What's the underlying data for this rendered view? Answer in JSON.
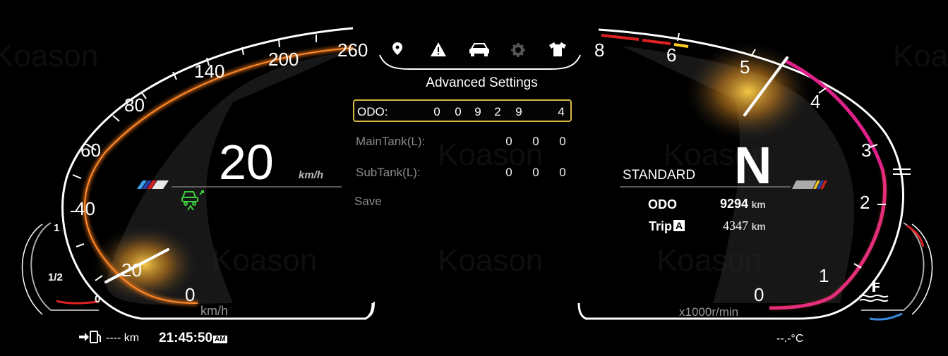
{
  "colors": {
    "background": "#000000",
    "arc_orange": "#ff7a1a",
    "rpm_magenta": "#e0208a",
    "redline": "#e02020",
    "selection_border": "#d4b642",
    "glow_yellow": "#ffd24a",
    "eco_green": "#3ccf3c"
  },
  "speedometer": {
    "tick_labels": [
      "0",
      "20",
      "40",
      "60",
      "80",
      "140",
      "200",
      "260"
    ],
    "unit": "km/h",
    "speed_value": "20",
    "speed_unit": "km/h",
    "needle_value_kmh": 20
  },
  "tachometer": {
    "tick_labels": [
      "0",
      "1",
      "2",
      "3",
      "4",
      "5",
      "6",
      "8"
    ],
    "unit": "x1000r/min",
    "needle_value_krpm": 5.2
  },
  "fuel_gauge": {
    "labels": [
      "1",
      "1/2",
      "0"
    ]
  },
  "menu": {
    "icons": [
      "location-pin-icon",
      "warning-triangle-icon",
      "car-icon",
      "gear-icon",
      "shirt-icon"
    ],
    "title": "Advanced Settings",
    "rows": [
      {
        "label": "ODO:",
        "digits": [
          "0",
          "0",
          "9",
          "2",
          "9",
          "4"
        ]
      },
      {
        "label": "MainTank(L):",
        "digits": [
          "0",
          "0",
          "0"
        ]
      },
      {
        "label": "SubTank(L):",
        "digits": [
          "0",
          "0",
          "0"
        ]
      }
    ],
    "save_label": "Save"
  },
  "right_info": {
    "gear": "N",
    "mode": "STANDARD",
    "odo_label": "ODO",
    "odo_value": "9294",
    "odo_unit": "km",
    "trip_label": "Trip",
    "trip_badge": "A",
    "trip_value": "4347",
    "trip_unit": "km"
  },
  "bottom_bar": {
    "range": "---- km",
    "time": "21:45:50",
    "ampm": "AM",
    "temperature": "--.-°C"
  },
  "watermark": "Koason"
}
